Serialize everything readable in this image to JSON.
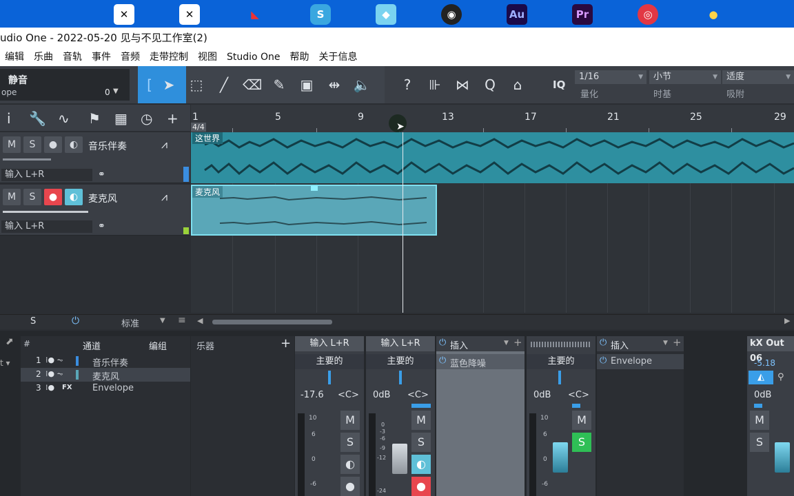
{
  "taskbar": {
    "icons": [
      "app-icon-1",
      "app-icon-2",
      "app-icon-3",
      "app-icon-4",
      "app-icon-5",
      "app-icon-6",
      "audition-icon",
      "premiere-icon",
      "app-icon-9",
      "app-icon-10"
    ],
    "au_label": "Au",
    "pr_label": "Pr"
  },
  "window": {
    "title": "udio One - 2022-05-20 见与不见工作室(2)"
  },
  "menu": [
    "编辑",
    "乐曲",
    "音轨",
    "事件",
    "音频",
    "走带控制",
    "视图",
    "Studio One",
    "帮助",
    "关于信息"
  ],
  "toolbar": {
    "left_label": "静音",
    "left_sub": "ope",
    "left_value": "0",
    "iq_label": "IQ",
    "quantize": {
      "value": "1/16",
      "label": "量化"
    },
    "timebase": {
      "value": "小节",
      "label": "时基"
    },
    "snap": {
      "value": "适度",
      "label": "吸附"
    }
  },
  "ruler": {
    "numbers": [
      "1",
      "5",
      "9",
      "13",
      "17",
      "21",
      "25",
      "29"
    ],
    "time_sig": "4/4"
  },
  "tracks": [
    {
      "index": "1",
      "name": "音乐伴奏",
      "input": "输入 L+R",
      "m": "M",
      "s": "S",
      "clip": "这世界",
      "color": "#2e8fa0"
    },
    {
      "index": "2",
      "name": "麦克风",
      "input": "输入 L+R",
      "m": "M",
      "s": "S",
      "clip": "麦克风",
      "color": "#5aa7b8"
    }
  ],
  "lowerbar": {
    "s_label": "S",
    "mode": "标准"
  },
  "console": {
    "headers": {
      "channel": "通道",
      "group": "编组",
      "instrument": "乐器",
      "hash": "#"
    },
    "channels": [
      {
        "num": "1",
        "name": "音乐伴奏"
      },
      {
        "num": "2",
        "name": "麦克风"
      },
      {
        "num": "3",
        "fx": "FX",
        "name": "Envelope"
      }
    ],
    "strips": [
      {
        "input": "输入 L+R",
        "route": "主要的",
        "level": "-17.6",
        "pan": "<C>"
      },
      {
        "input": "输入 L+R",
        "route": "主要的",
        "level": "0dB",
        "pan": "<C>"
      },
      {
        "insert": "插入",
        "plugin": "蓝色降噪"
      },
      {
        "route": "主要的",
        "level": "0dB",
        "pan": "<C>"
      },
      {
        "insert": "插入",
        "plugin": "Envelope"
      },
      {
        "out": "kX Out 06",
        "level_out": "-5.18",
        "level": "0dB"
      }
    ],
    "scale": [
      "10",
      "6",
      "0",
      "-6"
    ],
    "scale2": [
      "0",
      "-3",
      "-6",
      "-9",
      "-12",
      "-24"
    ],
    "m": "M",
    "s": "S"
  }
}
